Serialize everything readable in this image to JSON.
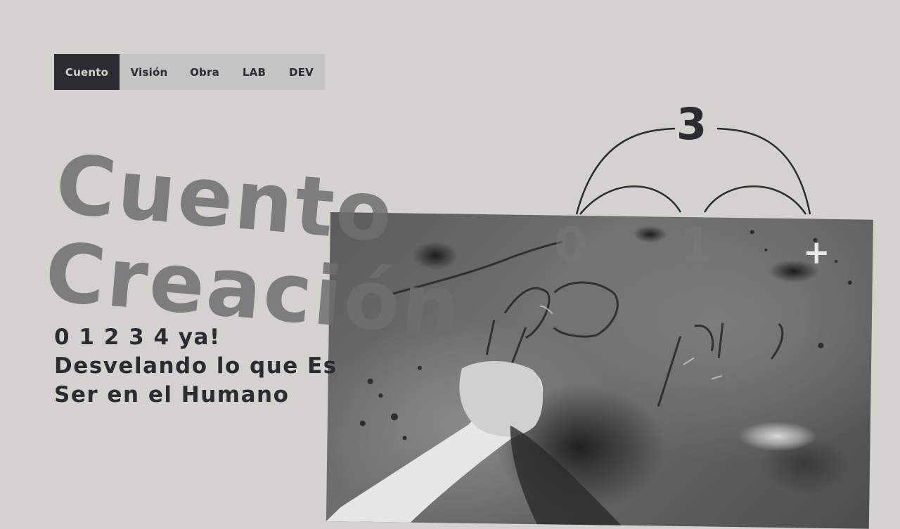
{
  "nav": {
    "items": [
      {
        "label": "Cuento",
        "active": true
      },
      {
        "label": "Visión",
        "active": false
      },
      {
        "label": "Obra",
        "active": false
      },
      {
        "label": "LAB",
        "active": false
      },
      {
        "label": "DEV",
        "active": false
      }
    ]
  },
  "hero": {
    "line1": "Cuento",
    "line2": "Creación"
  },
  "subtitle": {
    "line1": "0 1 2 3 4 ya!",
    "line2": "Desvelando lo que Es",
    "line3": "Ser en el Humano"
  },
  "diagram": {
    "top_number": "3",
    "left_number": "0",
    "right_number": "1",
    "plus_symbol": "+"
  },
  "photo": {
    "description_icon": "hand-writing-in-clay-photo"
  },
  "colors": {
    "background": "#d3d2ce",
    "dark": "#2a2c31",
    "nav_bg": "#c4c4c4"
  }
}
